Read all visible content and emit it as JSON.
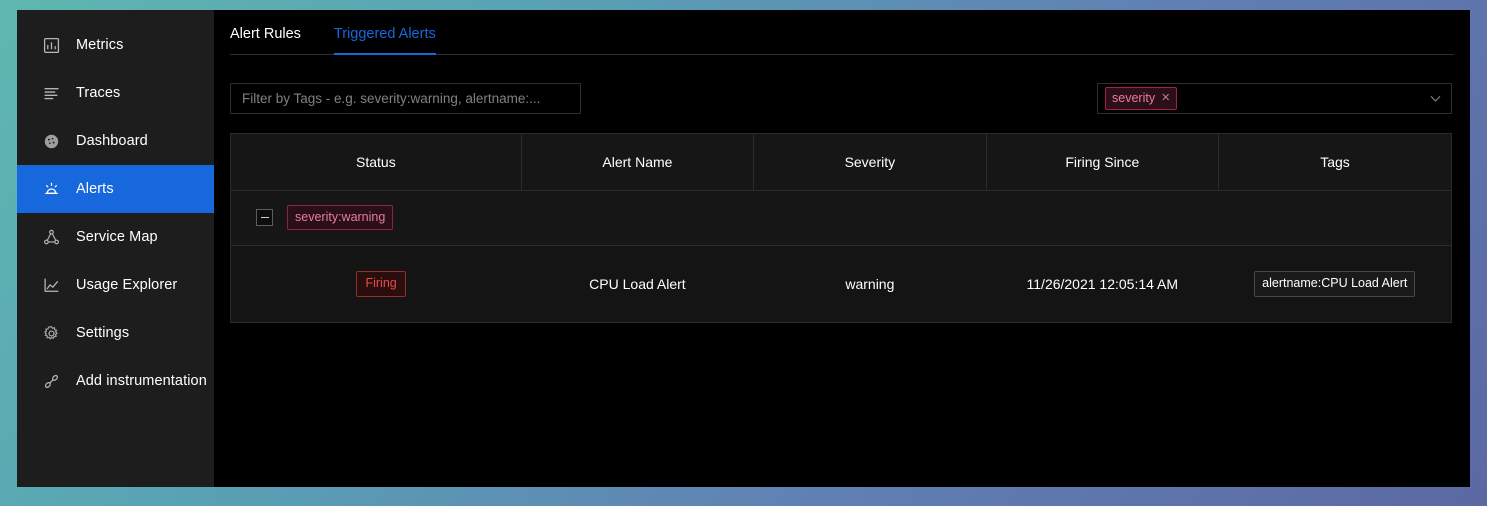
{
  "theme": {
    "accent": "#1668dc",
    "app_bg": "#000000",
    "sidebar_bg": "#1d1d1d",
    "chip_pink_text": "#e87ba8",
    "chip_pink_bg": "#2a1016",
    "chip_pink_border": "#a61d56",
    "badge_red_text": "#e84b4b",
    "badge_red_bg": "#2a0d0d",
    "badge_red_border": "#932e2e",
    "desktop_gradient_from": "#5fb7b0",
    "desktop_gradient_to": "#5c68a4"
  },
  "sidebar": {
    "items": [
      {
        "label": "Metrics",
        "icon": "bar-chart-icon",
        "active": false
      },
      {
        "label": "Traces",
        "icon": "list-lines-icon",
        "active": false
      },
      {
        "label": "Dashboard",
        "icon": "gauge-icon",
        "active": false
      },
      {
        "label": "Alerts",
        "icon": "alarm-bell-icon",
        "active": true
      },
      {
        "label": "Service Map",
        "icon": "node-graph-icon",
        "active": false
      },
      {
        "label": "Usage Explorer",
        "icon": "line-chart-icon",
        "active": false
      },
      {
        "label": "Settings",
        "icon": "gear-icon",
        "active": false
      },
      {
        "label": "Add instrumentation",
        "icon": "connector-link-icon",
        "active": false
      }
    ]
  },
  "tabs": [
    {
      "label": "Alert Rules",
      "active": false
    },
    {
      "label": "Triggered Alerts",
      "active": true
    }
  ],
  "filter": {
    "tag_input_placeholder": "Filter by Tags - e.g. severity:warning, alertname:...",
    "tag_input_value": "",
    "group_by_select": {
      "chips": [
        {
          "label": "severity",
          "close_icon": "close-x-icon"
        }
      ],
      "arrow_icon": "chevron-down-icon"
    }
  },
  "table": {
    "columns": [
      "Status",
      "Alert Name",
      "Severity",
      "Firing Since",
      "Tags"
    ],
    "groups": [
      {
        "expander_icon": "collapse-minus-icon",
        "expanded": true,
        "label": "severity:warning",
        "rows": [
          {
            "status": "Firing",
            "alert_name": "CPU Load Alert",
            "severity": "warning",
            "firing_since": "11/26/2021 12:05:14 AM",
            "tags": [
              "alertname:CPU Load Alert"
            ]
          }
        ]
      }
    ]
  }
}
